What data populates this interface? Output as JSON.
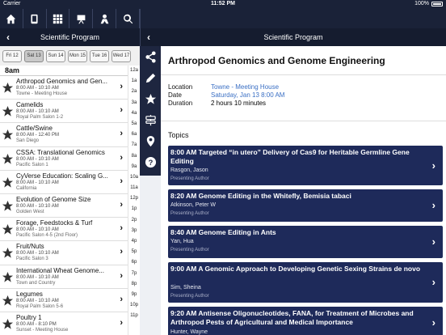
{
  "status_bar": {
    "carrier": "Carrier",
    "time": "11:52 PM",
    "battery": "100%"
  },
  "nav_icons": [
    "home-icon",
    "phone-icon",
    "grid-icon",
    "easel-icon",
    "person-icon",
    "search-icon"
  ],
  "left_header": {
    "title": "Scientific Program"
  },
  "right_header": {
    "title": "Scientific Program"
  },
  "date_tabs": [
    {
      "label": "Fri 12",
      "selected": false
    },
    {
      "label": "Sat 13",
      "selected": true
    },
    {
      "label": "Sun 14",
      "selected": false
    },
    {
      "label": "Mon 15",
      "selected": false
    },
    {
      "label": "Tue 16",
      "selected": false
    },
    {
      "label": "Wed 17",
      "selected": false
    }
  ],
  "time_header": "8am",
  "sessions": [
    {
      "title": "Arthropod Genomics and Gen...",
      "time": "8:00 AM - 10:10 AM",
      "location": "Towne - Meeting House"
    },
    {
      "title": "Camelids",
      "time": "8:00 AM - 10:10 AM",
      "location": "Royal Palm Salon 1-2"
    },
    {
      "title": "Cattle/Swine",
      "time": "8:00 AM - 12:40 PM",
      "location": "San Diego"
    },
    {
      "title": "CSSA: Translational Genomics",
      "time": "8:00 AM - 10:10 AM",
      "location": "Pacific Salon 1"
    },
    {
      "title": "CyVerse Education: Scaling G...",
      "time": "8:00 AM - 10:10 AM",
      "location": "California"
    },
    {
      "title": "Evolution of Genome Size",
      "time": "8:00 AM - 10:10 AM",
      "location": "Golden West"
    },
    {
      "title": "Forage, Feedstocks & Turf",
      "time": "8:00 AM - 10:10 AM",
      "location": "Pacific Salon 4-5 (2nd Floor)"
    },
    {
      "title": "Fruit/Nuts",
      "time": "8:00 AM - 10:10 AM",
      "location": "Pacific Salon 3"
    },
    {
      "title": "International Wheat Genome...",
      "time": "8:00 AM - 10:10 AM",
      "location": "Town and Country"
    },
    {
      "title": "Legumes",
      "time": "8:00 AM - 10:10 AM",
      "location": "Royal Palm Salon 5-6"
    },
    {
      "title": "Poultry 1",
      "time": "8:00 AM - 8:10 PM",
      "location": "Sunset - Meeting House"
    }
  ],
  "hour_index": [
    "12a",
    "1a",
    "2a",
    "3a",
    "4a",
    "5a",
    "6a",
    "7a",
    "8a",
    "9a",
    "10a",
    "11a",
    "12p",
    "1p",
    "2p",
    "3p",
    "4p",
    "5p",
    "6p",
    "7p",
    "8p",
    "9p",
    "10p",
    "11p"
  ],
  "action_icons": [
    "share-icon",
    "pencil-icon",
    "star-icon",
    "sign-icon",
    "map-pin-icon",
    "help-icon"
  ],
  "detail": {
    "title": "Arthropod Genomics and Genome Engineering",
    "location_label": "Location",
    "location_value": "Towne - Meeting House",
    "date_label": "Date",
    "date_value": "Saturday, Jan 13 8:00 AM",
    "duration_label": "Duration",
    "duration_value": "2 hours 10 minutes",
    "topics_label": "Topics",
    "topics": [
      {
        "title": "8:00 AM  Targeted “in utero” Delivery of Cas9 for Heritable Germline Gene Editing",
        "speaker": "Rasgon, Jason",
        "role": "Presenting Author"
      },
      {
        "title": "8:20 AM  Genome Editing in the Whitefly, Bemisia tabaci",
        "speaker": "Atkinson, Peter W",
        "role": "Presenting Author"
      },
      {
        "title": "8:40 AM  Genome Editing in Ants",
        "speaker": "Yan, Hua",
        "role": "Presenting Author"
      },
      {
        "title": "9:00 AM  A Genomic Approach to Developing Genetic Sexing Strains de novo",
        "speaker": "Sim, Sheina",
        "role": "Presenting Author"
      },
      {
        "title": "9:20 AM  Antisense Oligonucleotides, FANA, for Treatment of Microbes and Arthropod Pests of Agricultural and Medical Importance",
        "speaker": "Hunter, Wayne",
        "role": "Presenting Author"
      }
    ]
  },
  "colors": {
    "nav_bg": "#1a2238",
    "card_bg": "#1e2a5a",
    "link_blue": "#3a6fc4"
  }
}
